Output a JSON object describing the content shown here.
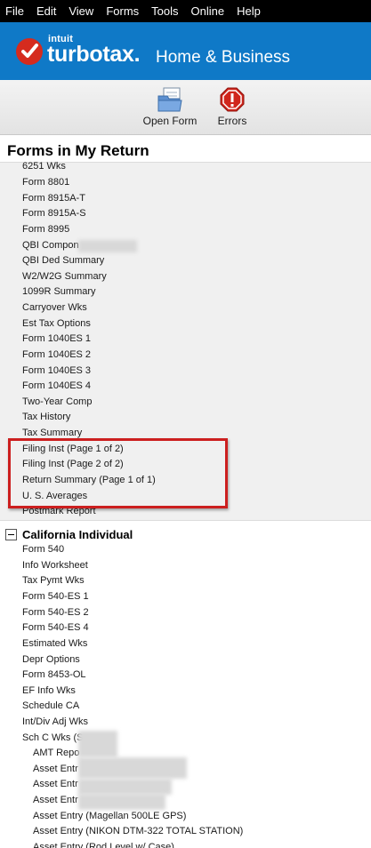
{
  "menu": [
    "File",
    "Edit",
    "View",
    "Forms",
    "Tools",
    "Online",
    "Help"
  ],
  "brand": {
    "intuit": "intuit",
    "product": "turbotax.",
    "edition": "Home & Business",
    "bg": "#0f79c7",
    "check_color": "#d52b1e"
  },
  "toolbar": {
    "open_form_label": "Open Form",
    "errors_label": "Errors"
  },
  "panel_title": "Forms in My Return",
  "federal_items": [
    "6251 Wks",
    "Form 8801",
    "Form 8915A-T",
    "Form 8915A-S",
    "Form 8995",
    "QBI Compon",
    "QBI Ded Summary",
    "W2/W2G Summary",
    "1099R Summary",
    "Carryover Wks",
    "Est Tax Options",
    "Form 1040ES 1",
    "Form 1040ES 2",
    "Form 1040ES 3",
    "Form 1040ES 4",
    "Two-Year Comp",
    "Tax History",
    "Tax Summary",
    "Filing Inst (Page 1 of 2)",
    "Filing Inst (Page 2 of 2)",
    "Return Summary (Page 1 of 1)",
    "U. S. Averages",
    "Postmark Report"
  ],
  "state_group": {
    "label": "California Individual",
    "expanded": true
  },
  "state_items": [
    "Form 540",
    "Info Worksheet",
    "Tax Pymt Wks",
    "Form 540-ES 1",
    "Form 540-ES 2",
    "Form 540-ES 4",
    "Estimated Wks",
    "Depr Options",
    "Form 8453-OL",
    "EF Info Wks",
    "Schedule CA",
    "Int/Div Adj Wks",
    "Sch C Wks (S"
  ],
  "sub_items": [
    "AMT Repo",
    "Asset Entr",
    "Asset Entr",
    "Asset Entr",
    "Asset Entry (Magellan 500LE GPS)",
    "Asset Entry (NIKON DTM-322 TOTAL STATION)",
    "Asset Entry (Rod Level w/ Case)"
  ],
  "highlight_color": "#cc1f1f"
}
